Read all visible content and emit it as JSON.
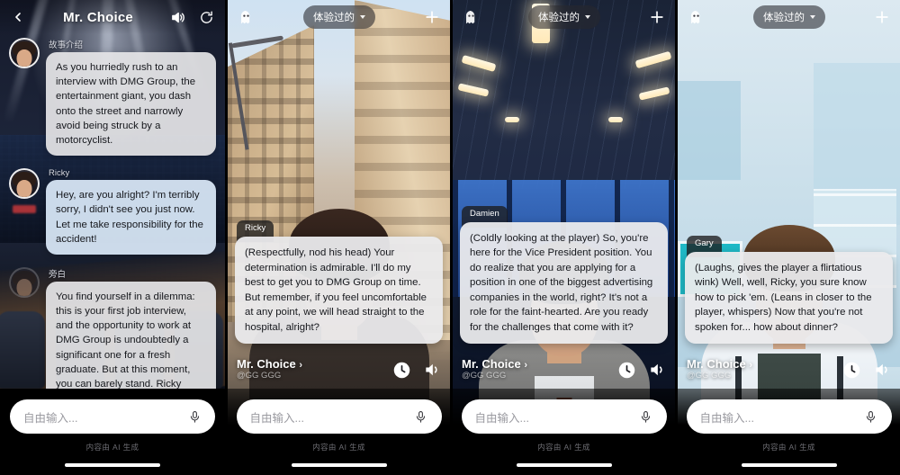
{
  "panels": [
    {
      "id": "chat-panel",
      "header": {
        "back_icon": "chevron-left-icon",
        "title": "Mr. Choice",
        "speaker_icon": "speaker-icon",
        "refresh_icon": "refresh-icon"
      },
      "messages": [
        {
          "speaker": "故事介绍",
          "text": "As you hurriedly rush to an interview with DMG Group, the entertainment giant, you dash onto the street and narrowly avoid being struck by a motorcyclist.",
          "style": "grey",
          "avatar": "character-avatar"
        },
        {
          "speaker": "Ricky",
          "text": "Hey, are you alright? I'm terribly sorry, I didn't see you just now. Let me take responsibility for the accident!",
          "style": "blue",
          "avatar": "character-avatar"
        },
        {
          "speaker": "旁白",
          "text": "You find yourself in a dilemma: this is your first job interview, and the opportunity to work at DMG Group is undoubtedly a significant one for a fresh graduate. But at this moment, you can barely stand. Ricky insists on taking you to the hospital.",
          "style": "grey",
          "avatar": "narrator-avatar"
        }
      ],
      "input": {
        "placeholder": "自由输入...",
        "mic_icon": "microphone-icon"
      },
      "ai_note": "内容由 AI 生成"
    },
    {
      "id": "street-scene-panel",
      "header": {
        "ghost_icon": "ghost-icon",
        "filter_label": "体验过的",
        "caret_icon": "caret-down-icon",
        "add_icon": "plus-icon"
      },
      "dialogue": {
        "speaker": "Ricky",
        "text": "(Respectfully, nod his head) Your determination is admirable. I'll do my best to get you to DMG Group on time. But remember, if you feel uncomfortable at any point, we will head straight to the hospital, alright?"
      },
      "character": {
        "name": "Mr. Choice",
        "chevron": "›",
        "handle": "@GG GGG",
        "history_icon": "clock-icon",
        "sound_icon": "speaker-icon"
      },
      "input": {
        "placeholder": "自由输入...",
        "mic_icon": "microphone-icon"
      },
      "ai_note": "内容由 AI 生成"
    },
    {
      "id": "office-scene-panel",
      "header": {
        "ghost_icon": "ghost-icon",
        "filter_label": "体验过的",
        "caret_icon": "caret-down-icon",
        "add_icon": "plus-icon"
      },
      "dialogue": {
        "speaker": "Damien",
        "text": "(Coldly looking at the player) So, you're here for the Vice President position. You do realize that you are applying for a position in one of the biggest advertising companies in the world, right? It's not a role for the faint-hearted. Are you ready for the challenges that come with it?"
      },
      "character": {
        "name": "Mr. Choice",
        "chevron": "›",
        "handle": "@GG GGG",
        "history_icon": "clock-icon",
        "sound_icon": "speaker-icon"
      },
      "input": {
        "placeholder": "自由输入...",
        "mic_icon": "microphone-icon"
      },
      "ai_note": "内容由 AI 生成"
    },
    {
      "id": "clinic-scene-panel",
      "header": {
        "ghost_icon": "ghost-icon",
        "filter_label": "体验过的",
        "caret_icon": "caret-down-icon",
        "add_icon": "plus-icon"
      },
      "dialogue": {
        "speaker": "Gary",
        "text": "(Laughs, gives the player a flirtatious wink) Well, well, Ricky, you sure know how to pick 'em. (Leans in closer to the player, whispers) Now that you're not spoken for... how about dinner?"
      },
      "character": {
        "name": "Mr. Choice",
        "chevron": "›",
        "handle": "@GG GGG",
        "history_icon": "clock-icon",
        "sound_icon": "speaker-icon"
      },
      "input": {
        "placeholder": "自由输入...",
        "mic_icon": "microphone-icon"
      },
      "ai_note": "内容由 AI 生成"
    }
  ],
  "colors": {
    "bubble_grey": "#e4e4e6",
    "bubble_blue": "#d6e5f4",
    "input_bg": "#ffffff",
    "pill_bg": "rgba(40,40,44,.58)",
    "text_dark": "#16181d"
  }
}
